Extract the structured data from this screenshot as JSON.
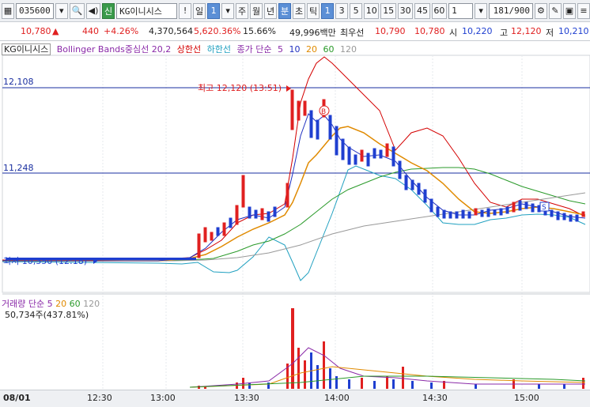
{
  "toolbar": {
    "code": "035600",
    "badge": "신",
    "name": "KG이니시스",
    "alert": "!",
    "period_day": "일",
    "period_num": "1",
    "periods": [
      "주",
      "월",
      "년",
      "분",
      "초",
      "틱"
    ],
    "minutes": [
      "1",
      "3",
      "5",
      "10",
      "15",
      "30",
      "45",
      "60"
    ],
    "interval": "1",
    "count": "181",
    "count_total": "/900"
  },
  "quote": {
    "price": "10,780",
    "arrow": "▲",
    "change": "440",
    "change_pct": "+4.26%",
    "volume": "4,370,564",
    "vol_ratio": "5,620.36%",
    "turnover": "15.66%",
    "amount": "49,996백만",
    "ask_label": "최우선",
    "ask1": "10,790",
    "bid1": "10,780",
    "open_label": "시",
    "open": "10,220",
    "high_label": "고",
    "high": "12,120",
    "low_label": "저",
    "low": "10,210"
  },
  "legend": {
    "name": "KG이니시스",
    "bollinger": "Bollinger Bands중심선 20,2",
    "upper": "상한선",
    "lower": "하한선",
    "ma_label": "종가 단순",
    "ma5": "5",
    "ma10": "10",
    "ma20": "20",
    "ma60": "60",
    "ma120": "120"
  },
  "price_levels": {
    "top": "12,108",
    "mid": "11,248"
  },
  "annotations": {
    "high": "최고 12,120 (13:51)",
    "low": "최저 10,350 (12:18)",
    "buy_marker": "B",
    "sell_marker": "S"
  },
  "volume_legend": {
    "label": "거래량",
    "ma_label": "단순",
    "ma5": "5",
    "ma20": "20",
    "ma60": "60",
    "ma120": "120",
    "info": "50,734주(437.81%)"
  },
  "time_axis": {
    "date": "08/01",
    "ticks": [
      "12:30",
      "13:00",
      "13:30",
      "14:00",
      "14:30",
      "15:00"
    ]
  },
  "colors": {
    "up": "#e02020",
    "down": "#1f3fd0",
    "ma5": "#2030c0",
    "ma10": "#e08a00",
    "ma20": "#2a9a2a",
    "ma60": "#999999",
    "upper": "#d40000",
    "lower": "#20a0c0",
    "center": "#2a9a2a",
    "purple": "#8a2aa8"
  }
}
